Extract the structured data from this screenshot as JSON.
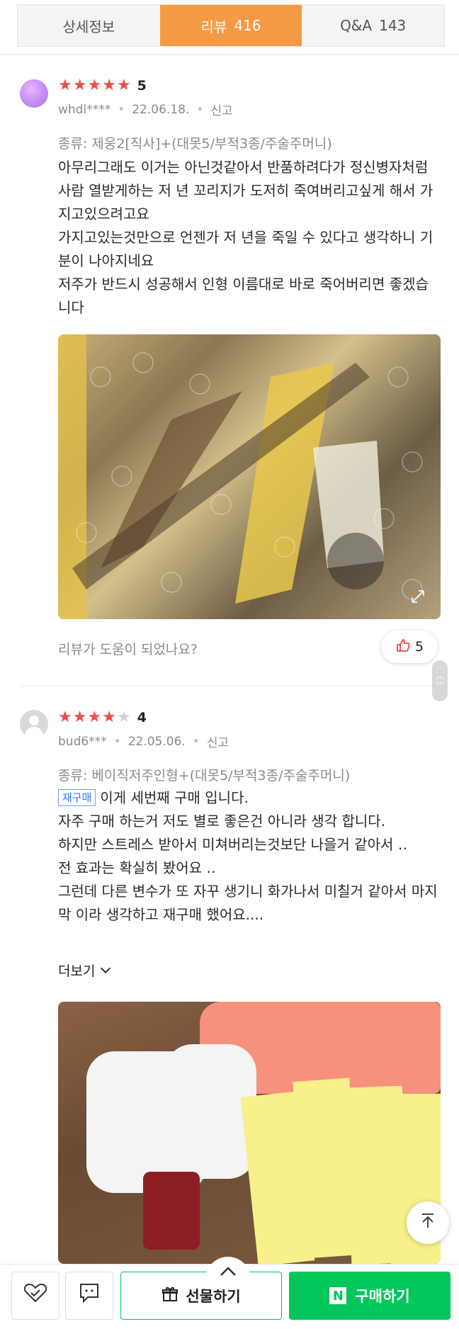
{
  "tabs": [
    {
      "label": "상세정보",
      "count": ""
    },
    {
      "label": "리뷰",
      "count": "416"
    },
    {
      "label": "Q&A",
      "count": "143"
    }
  ],
  "reviews": [
    {
      "rating": 5,
      "score_text": "5",
      "user": "whdl****",
      "date": "22.06.18.",
      "report_label": "신고",
      "option": "종류: 제웅2[직사]+(대못5/부적3종/주술주머니)",
      "paragraphs": [
        "아무리그래도 이거는 아닌것같아서 반품하려다가 정신병자처럼 사람 열받게하는 저 년 꼬리지가 도저히 죽여버리고싶게 해서 가지고있으려고요",
        "가지고있는것만으로 언젠가 저 년을 죽일 수 있다고 생각하니 기분이 나아지네요",
        "저주가 반드시 성공해서 인형 이름대로 바로 죽어버리면 좋겠습니다"
      ],
      "helpful_question": "리뷰가 도움이 되었나요?",
      "like_count": "5"
    },
    {
      "rating": 4,
      "score_text": "4",
      "user": "bud6***",
      "date": "22.05.06.",
      "report_label": "신고",
      "option": "종류: 베이직저주인형+(대못5/부적3종/주술주머니)",
      "badge": "재구매",
      "first_line": "이게 세번째 구매 입니다.",
      "paragraphs": [
        "자주 구매 하는거 저도 별로 좋은건 아니라 생각 합니다.",
        "하지만  스트레스 받아서 미쳐버리는것보단 나을거 같아서 ‥",
        "전 효과는 확실히 봤어요 ‥",
        "그런데 다른 변수가 또 자꾸 생기니 화가나서 미칠거 같아서  마지막 이라 생각하고 재구매 했어요...."
      ],
      "more_label": "더보기"
    }
  ],
  "bottom_bar": {
    "gift_label": "선물하기",
    "buy_label": "구매하기",
    "n_logo": "N"
  },
  "colors": {
    "accent": "#f59a44",
    "star": "#f04b4b",
    "buy_green": "#03c75a"
  },
  "icons": [
    "heart-check-icon",
    "talk-icon",
    "gift-icon",
    "thumbs-up-icon",
    "expand-icon",
    "scroll-top-icon",
    "chevron-down-icon"
  ]
}
